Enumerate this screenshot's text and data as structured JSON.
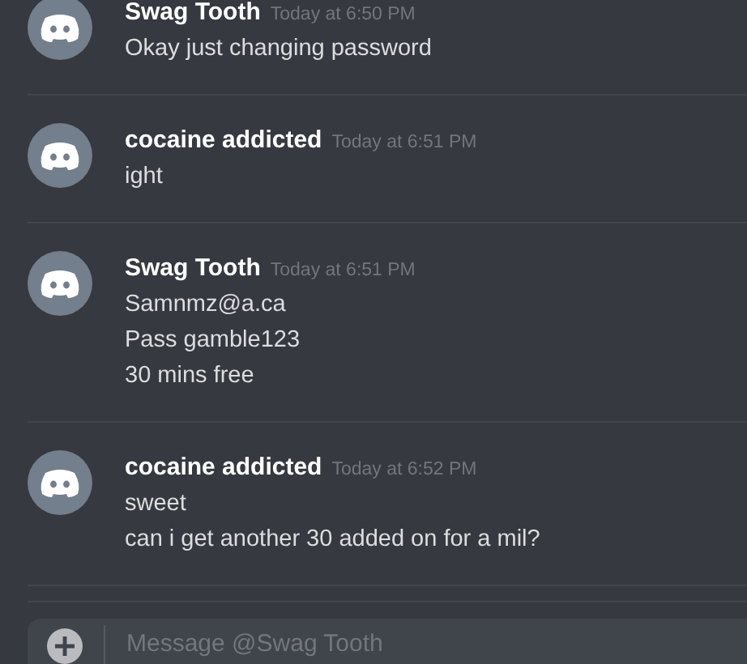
{
  "messages": [
    {
      "author": "Swag Tooth",
      "timestamp": "Today at 6:50 PM",
      "lines": [
        "Okay just changing password"
      ]
    },
    {
      "author": "cocaine addicted",
      "timestamp": "Today at 6:51 PM",
      "lines": [
        "ight"
      ]
    },
    {
      "author": "Swag Tooth",
      "timestamp": "Today at 6:51 PM",
      "lines": [
        "Samnmz@a.ca",
        "Pass gamble123",
        "30 mins free"
      ]
    },
    {
      "author": "cocaine addicted",
      "timestamp": "Today at 6:52 PM",
      "lines": [
        "sweet",
        "can i get another 30 added on for a mil?"
      ]
    }
  ],
  "composer": {
    "placeholder": "Message @Swag Tooth"
  }
}
